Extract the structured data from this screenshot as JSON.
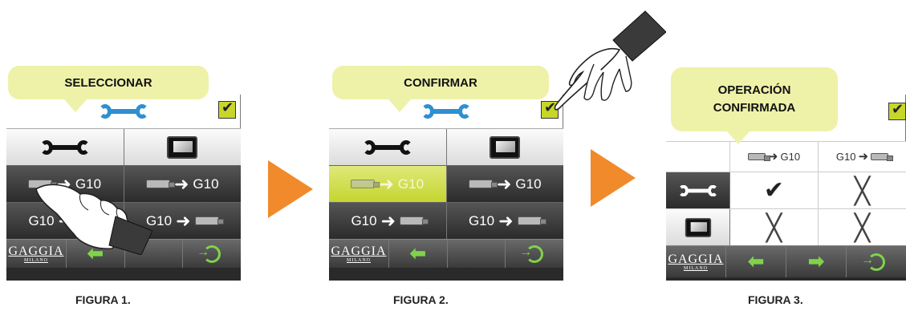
{
  "figures": [
    {
      "bubble": "SELECCIONAR",
      "caption": "FIGURA 1.",
      "g10": "G10"
    },
    {
      "bubble": "CONFIRMAR",
      "caption": "FIGURA 2.",
      "g10": "G10"
    },
    {
      "bubble": "OPERACIÓN CONFIRMADA",
      "caption": "FIGURA 3.",
      "g10": "G10"
    }
  ],
  "brand": {
    "name": "GAGGIA",
    "sub": "MILANO"
  },
  "colors": {
    "bubble": "#eef2a9",
    "selected": "#c4d52e",
    "arrow_accent": "#7fd34a",
    "play_arrow": "#f08a2a",
    "wrench_accent": "#2e8fd1"
  },
  "icons": [
    "wrench-icon",
    "monitor-icon",
    "usb-stick-icon",
    "check-icon",
    "x-mark-icon",
    "back-arrow-icon",
    "forward-arrow-icon",
    "exit-icon",
    "pointing-hand-icon"
  ]
}
